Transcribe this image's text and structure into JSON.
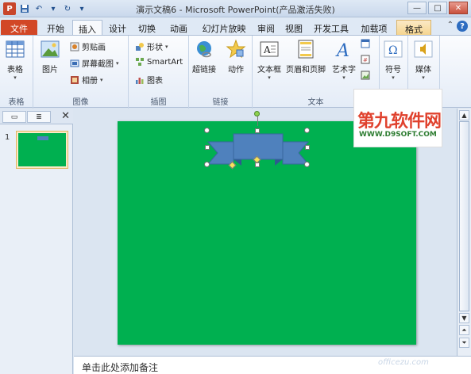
{
  "titlebar": {
    "title": "演示文稿6 - Microsoft PowerPoint(产品激活失败)",
    "icons": [
      "powerpoint-logo",
      "save-icon",
      "undo-icon",
      "redo-icon",
      "customize-icon"
    ],
    "controls": [
      "minimize",
      "maximize",
      "close"
    ]
  },
  "tabs": {
    "file": "文件",
    "items": [
      "开始",
      "插入",
      "设计",
      "切换",
      "动画",
      "幻灯片放映",
      "审阅",
      "视图",
      "开发工具",
      "加载项"
    ],
    "active": "插入",
    "contextual": "格式"
  },
  "ribbon": {
    "table_group": {
      "label": "表格",
      "table_btn": "表格"
    },
    "image_group": {
      "label": "图像",
      "picture_btn": "图片",
      "clipart_btn": "剪贴画",
      "screenshot_btn": "屏幕截图",
      "album_btn": "相册"
    },
    "illustration_group": {
      "label": "插图",
      "shapes_btn": "形状",
      "smartart_btn": "SmartArt",
      "chart_btn": "图表"
    },
    "links_group": {
      "label": "链接",
      "hyperlink_btn": "超链接",
      "action_btn": "动作"
    },
    "text_group": {
      "label": "文本",
      "textbox_btn": "文本框",
      "headerfooter_btn": "页眉和页脚",
      "wordart_btn": "艺术字"
    },
    "symbol_group": {
      "symbol_btn": "符号"
    },
    "media_group": {
      "media_btn": "媒体"
    }
  },
  "colors": {
    "slide_bg": "#00b050",
    "shape_fill": "#4f81bd",
    "file_tab": "#d24726"
  },
  "thumbnails": [
    {
      "number": "1"
    }
  ],
  "notes": {
    "placeholder": "单击此处添加备注"
  },
  "watermark": {
    "main": "第九软件网",
    "sub": "WWW.D9SOFT.COM",
    "bottom": "officezu.com"
  }
}
